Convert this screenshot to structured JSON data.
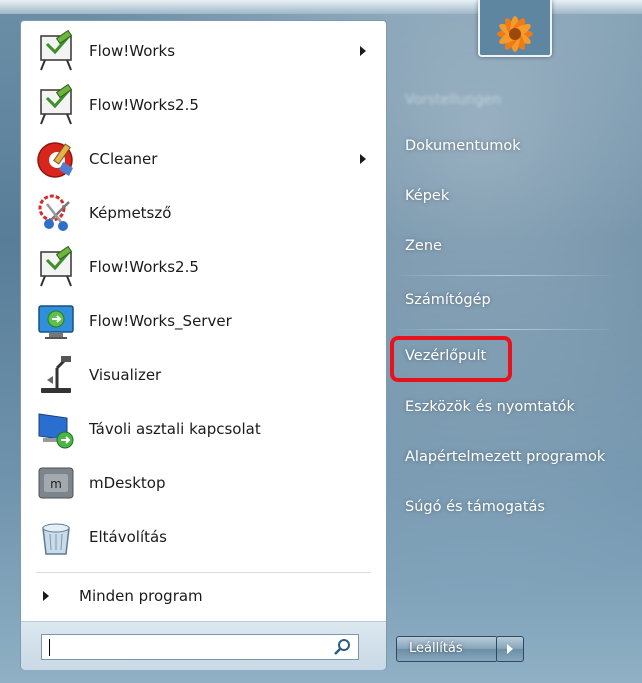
{
  "programs": [
    {
      "label": "Flow!Works",
      "icon": "flowworks-icon",
      "submenu": true
    },
    {
      "label": "Flow!Works2.5",
      "icon": "flowworks-icon",
      "submenu": false
    },
    {
      "label": "CCleaner",
      "icon": "ccleaner-icon",
      "submenu": true
    },
    {
      "label": "Képmetsző",
      "icon": "snipping-tool-icon",
      "submenu": false
    },
    {
      "label": "Flow!Works2.5",
      "icon": "flowworks-icon",
      "submenu": false
    },
    {
      "label": "Flow!Works_Server",
      "icon": "server-icon",
      "submenu": false
    },
    {
      "label": "Visualizer",
      "icon": "visualizer-icon",
      "submenu": false
    },
    {
      "label": "Távoli asztali kapcsolat",
      "icon": "remote-desktop-icon",
      "submenu": false
    },
    {
      "label": "mDesktop",
      "icon": "mdesktop-icon",
      "submenu": false
    },
    {
      "label": "Eltávolítás",
      "icon": "uninstall-icon",
      "submenu": false
    }
  ],
  "all_programs_label": "Minden program",
  "search": {
    "value": "",
    "placeholder": ""
  },
  "right_items": [
    {
      "label": "Dokumentumok"
    },
    {
      "label": "Képek"
    },
    {
      "label": "Zene"
    },
    {
      "label": "Számítógép"
    },
    {
      "label": "Vezérlőpult"
    },
    {
      "label": "Eszközök és nyomtatók"
    },
    {
      "label": "Alapértelmezett programok"
    },
    {
      "label": "Súgó és támogatás"
    }
  ],
  "shutdown_label": "Leállítás",
  "colors": {
    "highlight": "#e8121d",
    "pane_bg": "#ffffff"
  }
}
